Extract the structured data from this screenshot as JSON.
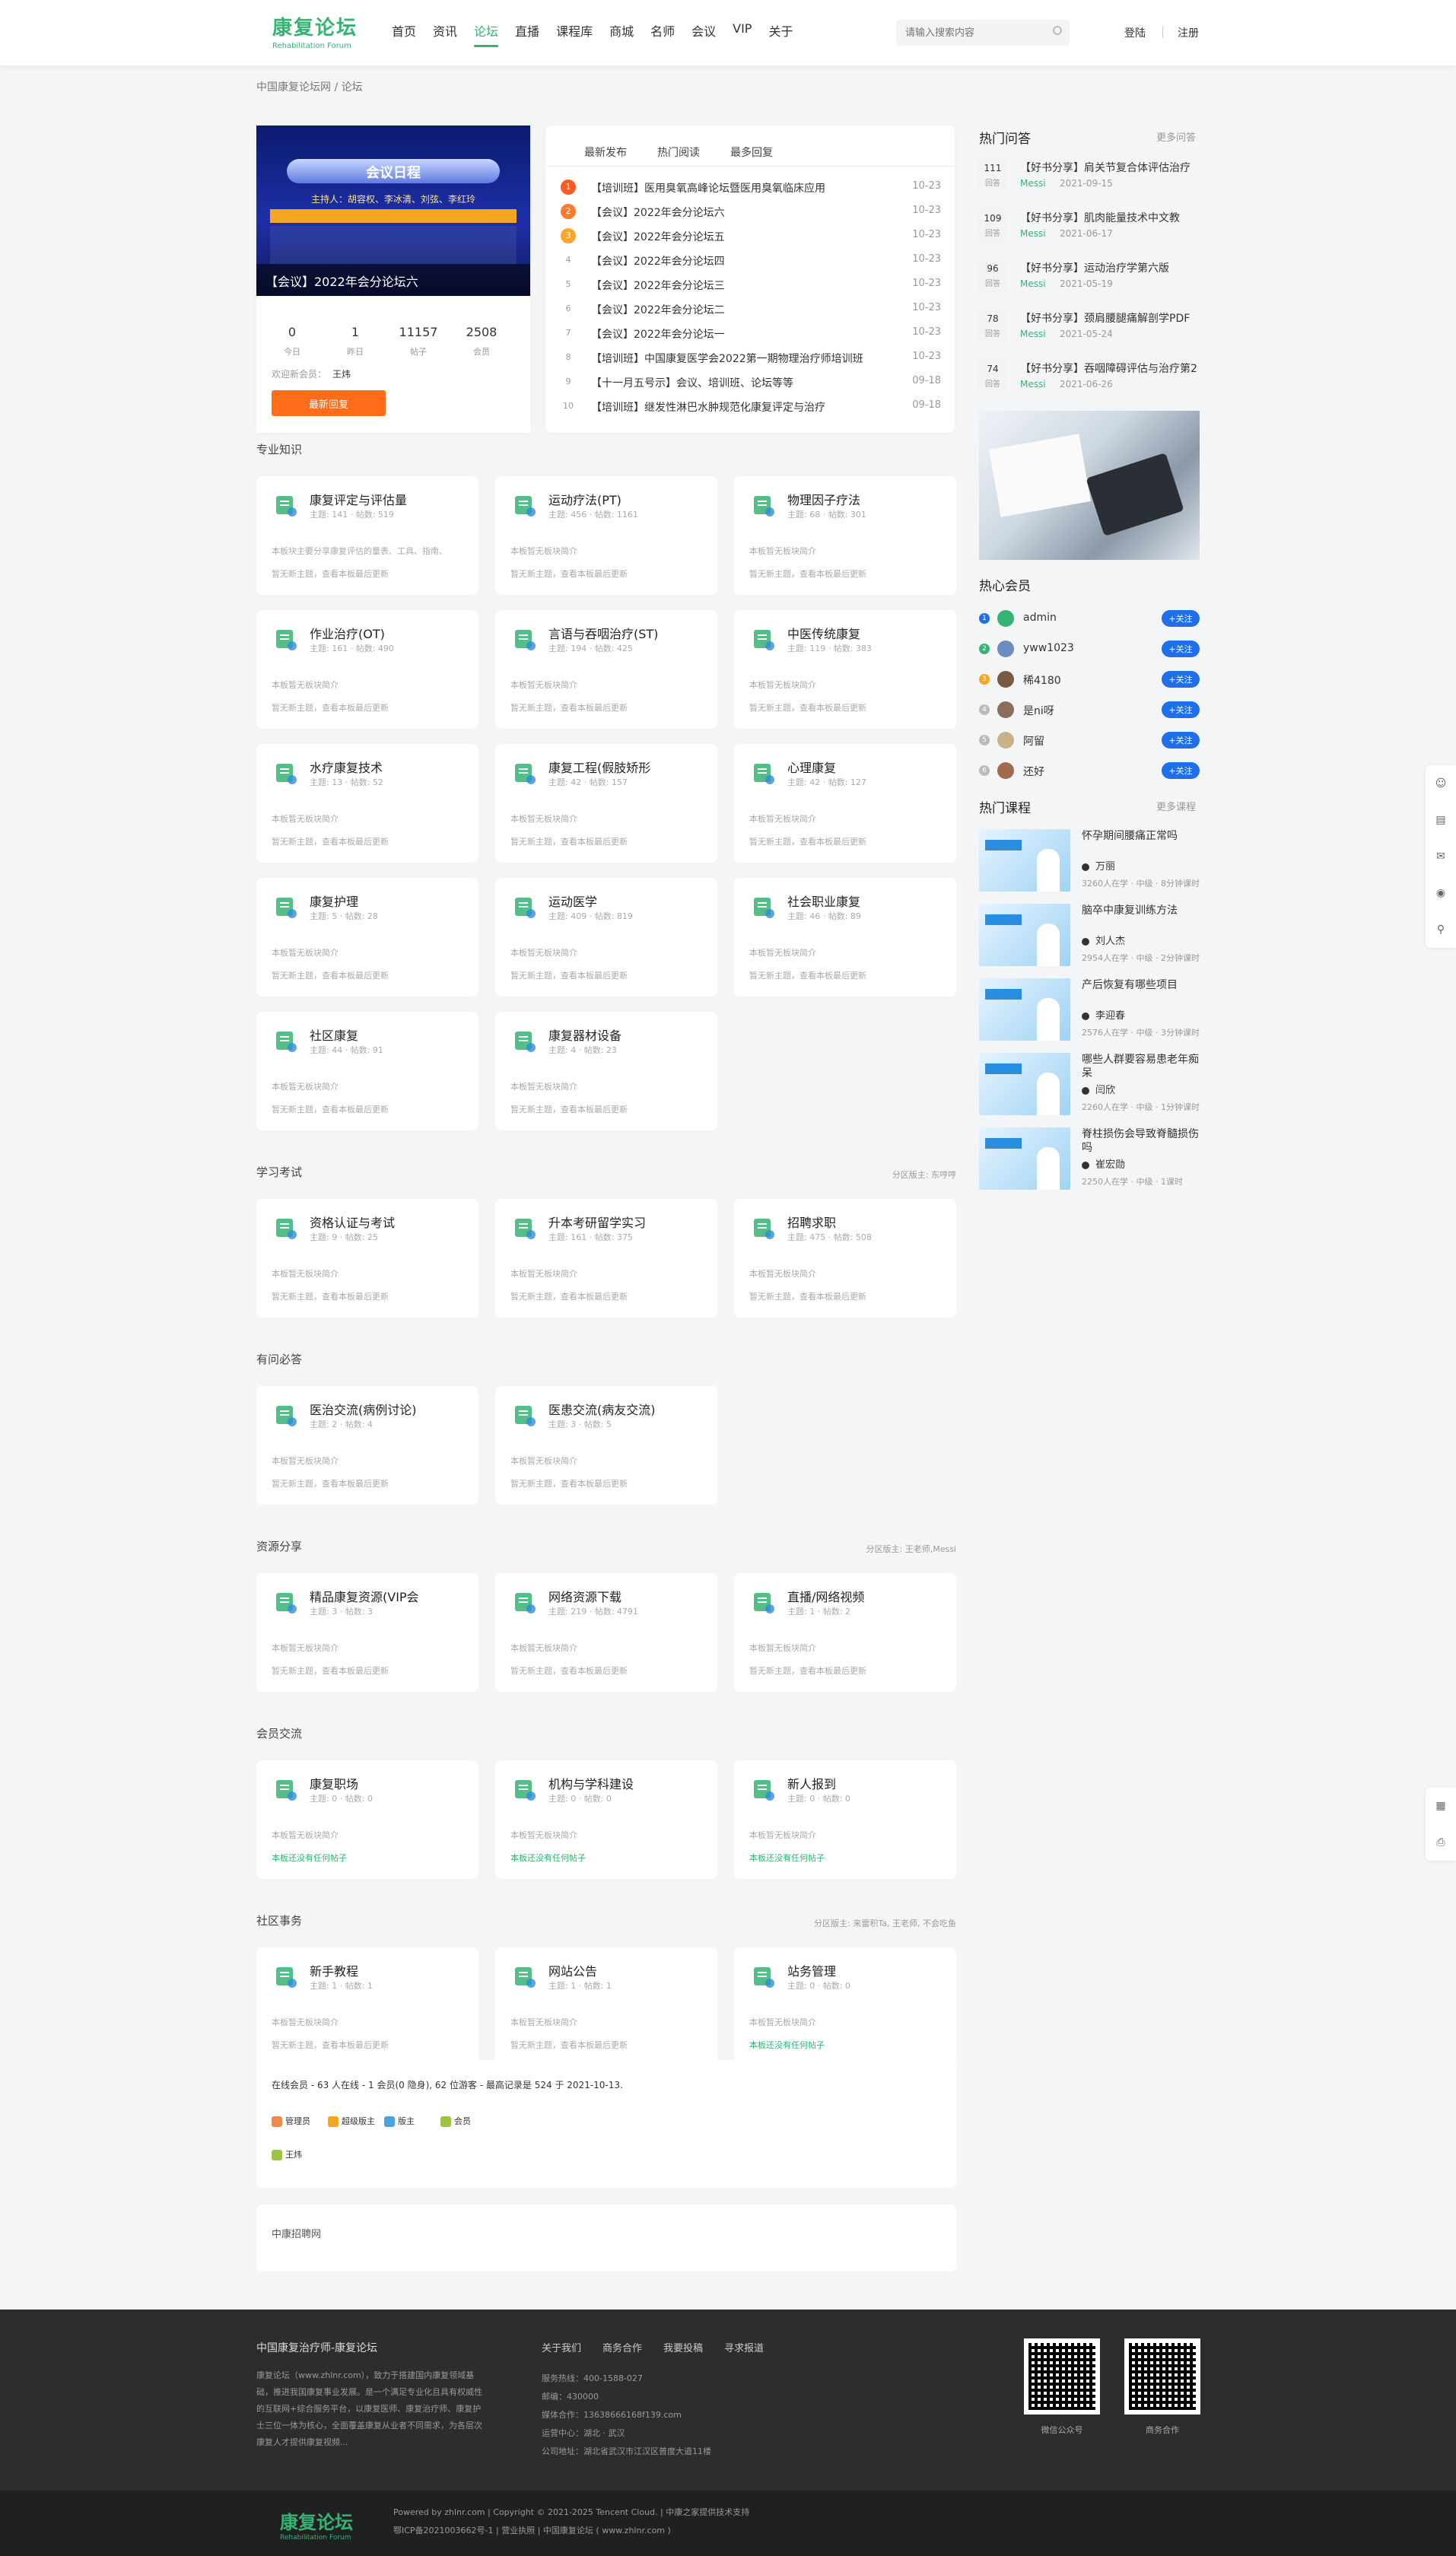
{
  "header": {
    "logo_cn": "康复论坛",
    "logo_en": "Rehabilitation Forum",
    "nav": [
      "首页",
      "资讯",
      "论坛",
      "直播",
      "课程库",
      "商城",
      "名师",
      "会议",
      "VIP",
      "关于"
    ],
    "active_nav": 2,
    "search_placeholder": "请输入搜索内容",
    "login": "登陆",
    "register": "注册"
  },
  "breadcrumb": "中国康复论坛网 / 论坛",
  "slide": {
    "title": "会议日程",
    "hosts": "主持人：胡容权、李冰清、刘弦、李红玲",
    "caption": "【会议】2022年会分论坛六"
  },
  "stats": [
    {
      "value": "0",
      "label": "今日"
    },
    {
      "value": "1",
      "label": "昨日"
    },
    {
      "value": "11157",
      "label": "帖子"
    },
    {
      "value": "2508",
      "label": "会员"
    }
  ],
  "welcome_label": "欢迎新会员：",
  "welcome_user": "王炜",
  "reply_button": "最新回复",
  "news_tabs": [
    "最新发布",
    "热门阅读",
    "最多回复"
  ],
  "news": [
    {
      "n": "1",
      "title": "【培训班】医用臭氧高峰论坛暨医用臭氧临床应用",
      "date": "10-23"
    },
    {
      "n": "2",
      "title": "【会议】2022年会分论坛六",
      "date": "10-23"
    },
    {
      "n": "3",
      "title": "【会议】2022年会分论坛五",
      "date": "10-23"
    },
    {
      "n": "4",
      "title": "【会议】2022年会分论坛四",
      "date": "10-23"
    },
    {
      "n": "5",
      "title": "【会议】2022年会分论坛三",
      "date": "10-23"
    },
    {
      "n": "6",
      "title": "【会议】2022年会分论坛二",
      "date": "10-23"
    },
    {
      "n": "7",
      "title": "【会议】2022年会分论坛一",
      "date": "10-23"
    },
    {
      "n": "8",
      "title": "【培训班】中国康复医学会2022第一期物理治疗师培训班",
      "date": "10-23"
    },
    {
      "n": "9",
      "title": "【十一月五号示】会议、培训班、论坛等等",
      "date": "09-18"
    },
    {
      "n": "10",
      "title": "【培训班】继发性淋巴水肿规范化康复评定与治疗",
      "date": "09-18"
    }
  ],
  "sections": [
    {
      "title": "专业知识",
      "mod": "",
      "forums": [
        {
          "name": "康复评定与评估量",
          "meta": "主题: 141 · 帖数: 519",
          "desc": "本板块主要分享康复评估的量表、工具、指南、",
          "last": "暂无新主题，查看本板最后更新",
          "icon": "assessment-icon"
        },
        {
          "name": "运动疗法(PT)",
          "meta": "主题: 456 · 帖数: 1161",
          "desc": "本板暂无板块简介",
          "last": "暂无新主题，查看本板最后更新",
          "icon": "exercise-therapy-icon"
        },
        {
          "name": "物理因子疗法",
          "meta": "主题: 68 · 帖数: 301",
          "desc": "本板暂无板块简介",
          "last": "暂无新主题，查看本板最后更新",
          "icon": "physical-agent-icon"
        },
        {
          "name": "作业治疗(OT)",
          "meta": "主题: 161 · 帖数: 490",
          "desc": "本板暂无板块简介",
          "last": "暂无新主题，查看本板最后更新",
          "icon": "occupational-therapy-icon"
        },
        {
          "name": "言语与吞咽治疗(ST)",
          "meta": "主题: 194 · 帖数: 425",
          "desc": "本板暂无板块简介",
          "last": "暂无新主题，查看本板最后更新",
          "icon": "speech-therapy-icon"
        },
        {
          "name": "中医传统康复",
          "meta": "主题: 119 · 帖数: 383",
          "desc": "本板暂无板块简介",
          "last": "暂无新主题，查看本板最后更新",
          "icon": "tcm-icon"
        },
        {
          "name": "水疗康复技术",
          "meta": "主题: 13 · 帖数: 52",
          "desc": "本板暂无板块简介",
          "last": "暂无新主题，查看本板最后更新",
          "icon": "hydrotherapy-icon"
        },
        {
          "name": "康复工程(假肢矫形",
          "meta": "主题: 42 · 帖数: 157",
          "desc": "本板暂无板块简介",
          "last": "暂无新主题，查看本板最后更新",
          "icon": "prosthetics-icon"
        },
        {
          "name": "心理康复",
          "meta": "主题: 42 · 帖数: 127",
          "desc": "本板暂无板块简介",
          "last": "暂无新主题，查看本板最后更新",
          "icon": "psychology-icon"
        },
        {
          "name": "康复护理",
          "meta": "主题: 5 · 帖数: 28",
          "desc": "本板暂无板块简介",
          "last": "暂无新主题，查看本板最后更新",
          "icon": "nursing-icon"
        },
        {
          "name": "运动医学",
          "meta": "主题: 409 · 帖数: 819",
          "desc": "本板暂无板块简介",
          "last": "暂无新主题，查看本板最后更新",
          "icon": "sports-medicine-icon"
        },
        {
          "name": "社会职业康复",
          "meta": "主题: 46 · 帖数: 89",
          "desc": "本板暂无板块简介",
          "last": "暂无新主题，查看本板最后更新",
          "icon": "vocational-icon"
        },
        {
          "name": "社区康复",
          "meta": "主题: 44 · 帖数: 91",
          "desc": "本板暂无板块简介",
          "last": "暂无新主题，查看本板最后更新",
          "icon": "community-icon"
        },
        {
          "name": "康复器材设备",
          "meta": "主题: 4 · 帖数: 23",
          "desc": "本板暂无板块简介",
          "last": "暂无新主题，查看本板最后更新",
          "icon": "equipment-icon"
        }
      ]
    },
    {
      "title": "学习考试",
      "mod": "分区版主: 东哼哼",
      "forums": [
        {
          "name": "资格认证与考试",
          "meta": "主题: 9 · 帖数: 25",
          "desc": "本板暂无板块简介",
          "last": "暂无新主题，查看本板最后更新",
          "icon": "certificate-icon"
        },
        {
          "name": "升本考研留学实习",
          "meta": "主题: 161 · 帖数: 375",
          "desc": "本板暂无板块简介",
          "last": "暂无新主题，查看本板最后更新",
          "icon": "graduation-cap-icon"
        },
        {
          "name": "招聘求职",
          "meta": "主题: 475 · 帖数: 508",
          "desc": "本板暂无板块简介",
          "last": "暂无新主题，查看本板最后更新",
          "icon": "job-icon"
        }
      ]
    },
    {
      "title": "有问必答",
      "mod": "",
      "forums": [
        {
          "name": "医治交流(病例讨论)",
          "meta": "主题: 2 · 帖数: 4",
          "desc": "本板暂无板块简介",
          "last": "暂无新主题，查看本板最后更新",
          "icon": "doctor-icon"
        },
        {
          "name": "医患交流(病友交流)",
          "meta": "主题: 3 · 帖数: 5",
          "desc": "本板暂无板块简介",
          "last": "暂无新主题，查看本板最后更新",
          "icon": "patients-icon"
        }
      ]
    },
    {
      "title": "资源分享",
      "mod": "分区版主: 王老师,Messi",
      "forums": [
        {
          "name": "精品康复资源(VIP会",
          "meta": "主题: 3 · 帖数: 3",
          "desc": "本板暂无板块简介",
          "last": "暂无新主题，查看本板最后更新",
          "icon": "download-icon"
        },
        {
          "name": "网络资源下载",
          "meta": "主题: 219 · 帖数: 4791",
          "desc": "本板暂无板块简介",
          "last": "暂无新主题，查看本板最后更新",
          "icon": "file-download-icon"
        },
        {
          "name": "直播/网络视频",
          "meta": "主题: 1 · 帖数: 2",
          "desc": "本板暂无板块简介",
          "last": "暂无新主题，查看本板最后更新",
          "icon": "video-icon"
        }
      ]
    },
    {
      "title": "会员交流",
      "mod": "",
      "forums": [
        {
          "name": "康复职场",
          "meta": "主题: 0 · 帖数: 0",
          "desc": "本板暂无板块简介",
          "last": "本板还没有任何帖子",
          "icon": "workplace-icon"
        },
        {
          "name": "机构与学科建设",
          "meta": "主题: 0 · 帖数: 0",
          "desc": "本板暂无板块简介",
          "last": "本板还没有任何帖子",
          "icon": "hospital-icon"
        },
        {
          "name": "新人报到",
          "meta": "主题: 0 · 帖数: 0",
          "desc": "本板暂无板块简介",
          "last": "本板还没有任何帖子",
          "icon": "newcomer-icon"
        }
      ]
    },
    {
      "title": "社区事务",
      "mod": "分区版主: 来雷积Ta, 王老师, 不会吃鱼",
      "forums": [
        {
          "name": "新手教程",
          "meta": "主题: 1 · 帖数: 1",
          "desc": "本板暂无板块简介",
          "last": "暂无新主题，查看本板最后更新",
          "icon": "tutorial-icon"
        },
        {
          "name": "网站公告",
          "meta": "主题: 1 · 帖数: 1",
          "desc": "本板暂无板块简介",
          "last": "暂无新主题，查看本板最后更新",
          "icon": "announcement-icon"
        },
        {
          "name": "站务管理",
          "meta": "主题: 0 · 帖数: 0",
          "desc": "本板暂无板块简介",
          "last": "本板还没有任何帖子",
          "icon": "admin-icon"
        }
      ]
    }
  ],
  "hot_qa": {
    "title": "热门问答",
    "more": "更多问答",
    "answer_label": "回答",
    "items": [
      {
        "count": "111",
        "q": "【好书分享】肩关节复合体评估治疗",
        "user": "Messi",
        "date": "2021-09-15"
      },
      {
        "count": "109",
        "q": "【好书分享】肌肉能量技术中文教",
        "user": "Messi",
        "date": "2021-06-17"
      },
      {
        "count": "96",
        "q": "【好书分享】运动治疗学第六版",
        "user": "Messi",
        "date": "2021-05-19"
      },
      {
        "count": "78",
        "q": "【好书分享】颈肩腰腿痛解剖学PDF",
        "user": "Messi",
        "date": "2021-05-24"
      },
      {
        "count": "74",
        "q": "【好书分享】吞咽障碍评估与治疗第2",
        "user": "Messi",
        "date": "2021-06-26"
      }
    ]
  },
  "hot_members": {
    "title": "热心会员",
    "follow": "+关注",
    "items": [
      {
        "rank": "1",
        "name": "admin"
      },
      {
        "rank": "2",
        "name": "yww1023"
      },
      {
        "rank": "3",
        "name": "稀4180"
      },
      {
        "rank": "4",
        "name": "是ni呀"
      },
      {
        "rank": "5",
        "name": "阿留"
      },
      {
        "rank": "6",
        "name": "还好"
      }
    ]
  },
  "hot_courses": {
    "title": "热门课程",
    "more": "更多课程",
    "items": [
      {
        "title": "怀孕期间腰痛正常吗",
        "teacher": "万丽",
        "meta": "3260人在学 · 中级 · 8分钟课时"
      },
      {
        "title": "脑卒中康复训练方法",
        "teacher": "刘人杰",
        "meta": "2954人在学 · 中级 · 2分钟课时"
      },
      {
        "title": "产后恢复有哪些项目",
        "teacher": "李迎春",
        "meta": "2576人在学 · 中级 · 3分钟课时"
      },
      {
        "title": "哪些人群要容易患老年痴呆",
        "teacher": "闫欣",
        "meta": "2260人在学 · 中级 · 1分钟课时"
      },
      {
        "title": "脊柱损伤会导致脊髓损伤吗",
        "teacher": "崔宏勋",
        "meta": "2250人在学 · 中级 · 1课时"
      }
    ]
  },
  "online": {
    "text": "在线会员 - 63 人在线 - 1 会员(0 隐身), 62 位游客 - 最高记录是 524 于 2021-10-13.",
    "legend": [
      {
        "label": "管理员",
        "color": "#f08a4b"
      },
      {
        "label": "超级版主",
        "color": "#f5a623"
      },
      {
        "label": "版主",
        "color": "#4aa3df"
      },
      {
        "label": "会员",
        "color": "#9bc53d"
      }
    ],
    "user": "王炜"
  },
  "links": {
    "text": "中康招聘网"
  },
  "footer": {
    "title": "中国康复治疗师-康复论坛",
    "about": "康复论坛（www.zhlnr.com），致力于搭建国内康复领域基础，推进我国康复事业发展。是一个满足专业化且具有权威性的互联网+综合服务平台，以康复医师、康复治疗师、康复护士三位一体为核心，全面覆盖康复从业者不同需求，为各层次康复人才提供康复视频...",
    "links": [
      "关于我们",
      "商务合作",
      "我要投稿",
      "寻求报道"
    ],
    "contact": [
      "服务热线：400-1588-027",
      "邮编：430000",
      "媒体合作：13638666168f139.com",
      "运营中心：湖北 · 武汉",
      "公司地址：湖北省武汉市江汉区普度大道11楼"
    ],
    "qr1": "微信公众号",
    "qr2": "商务合作",
    "bottom1": "Powered by zhlnr.com  |  Copyright © 2021-2025 Tencent Cloud.  |  中康之家提供技术支持",
    "bottom2": "鄂ICP备2021003662号-1  |  营业执照  |  中国康复论坛 ( www.zhlnr.com )"
  }
}
